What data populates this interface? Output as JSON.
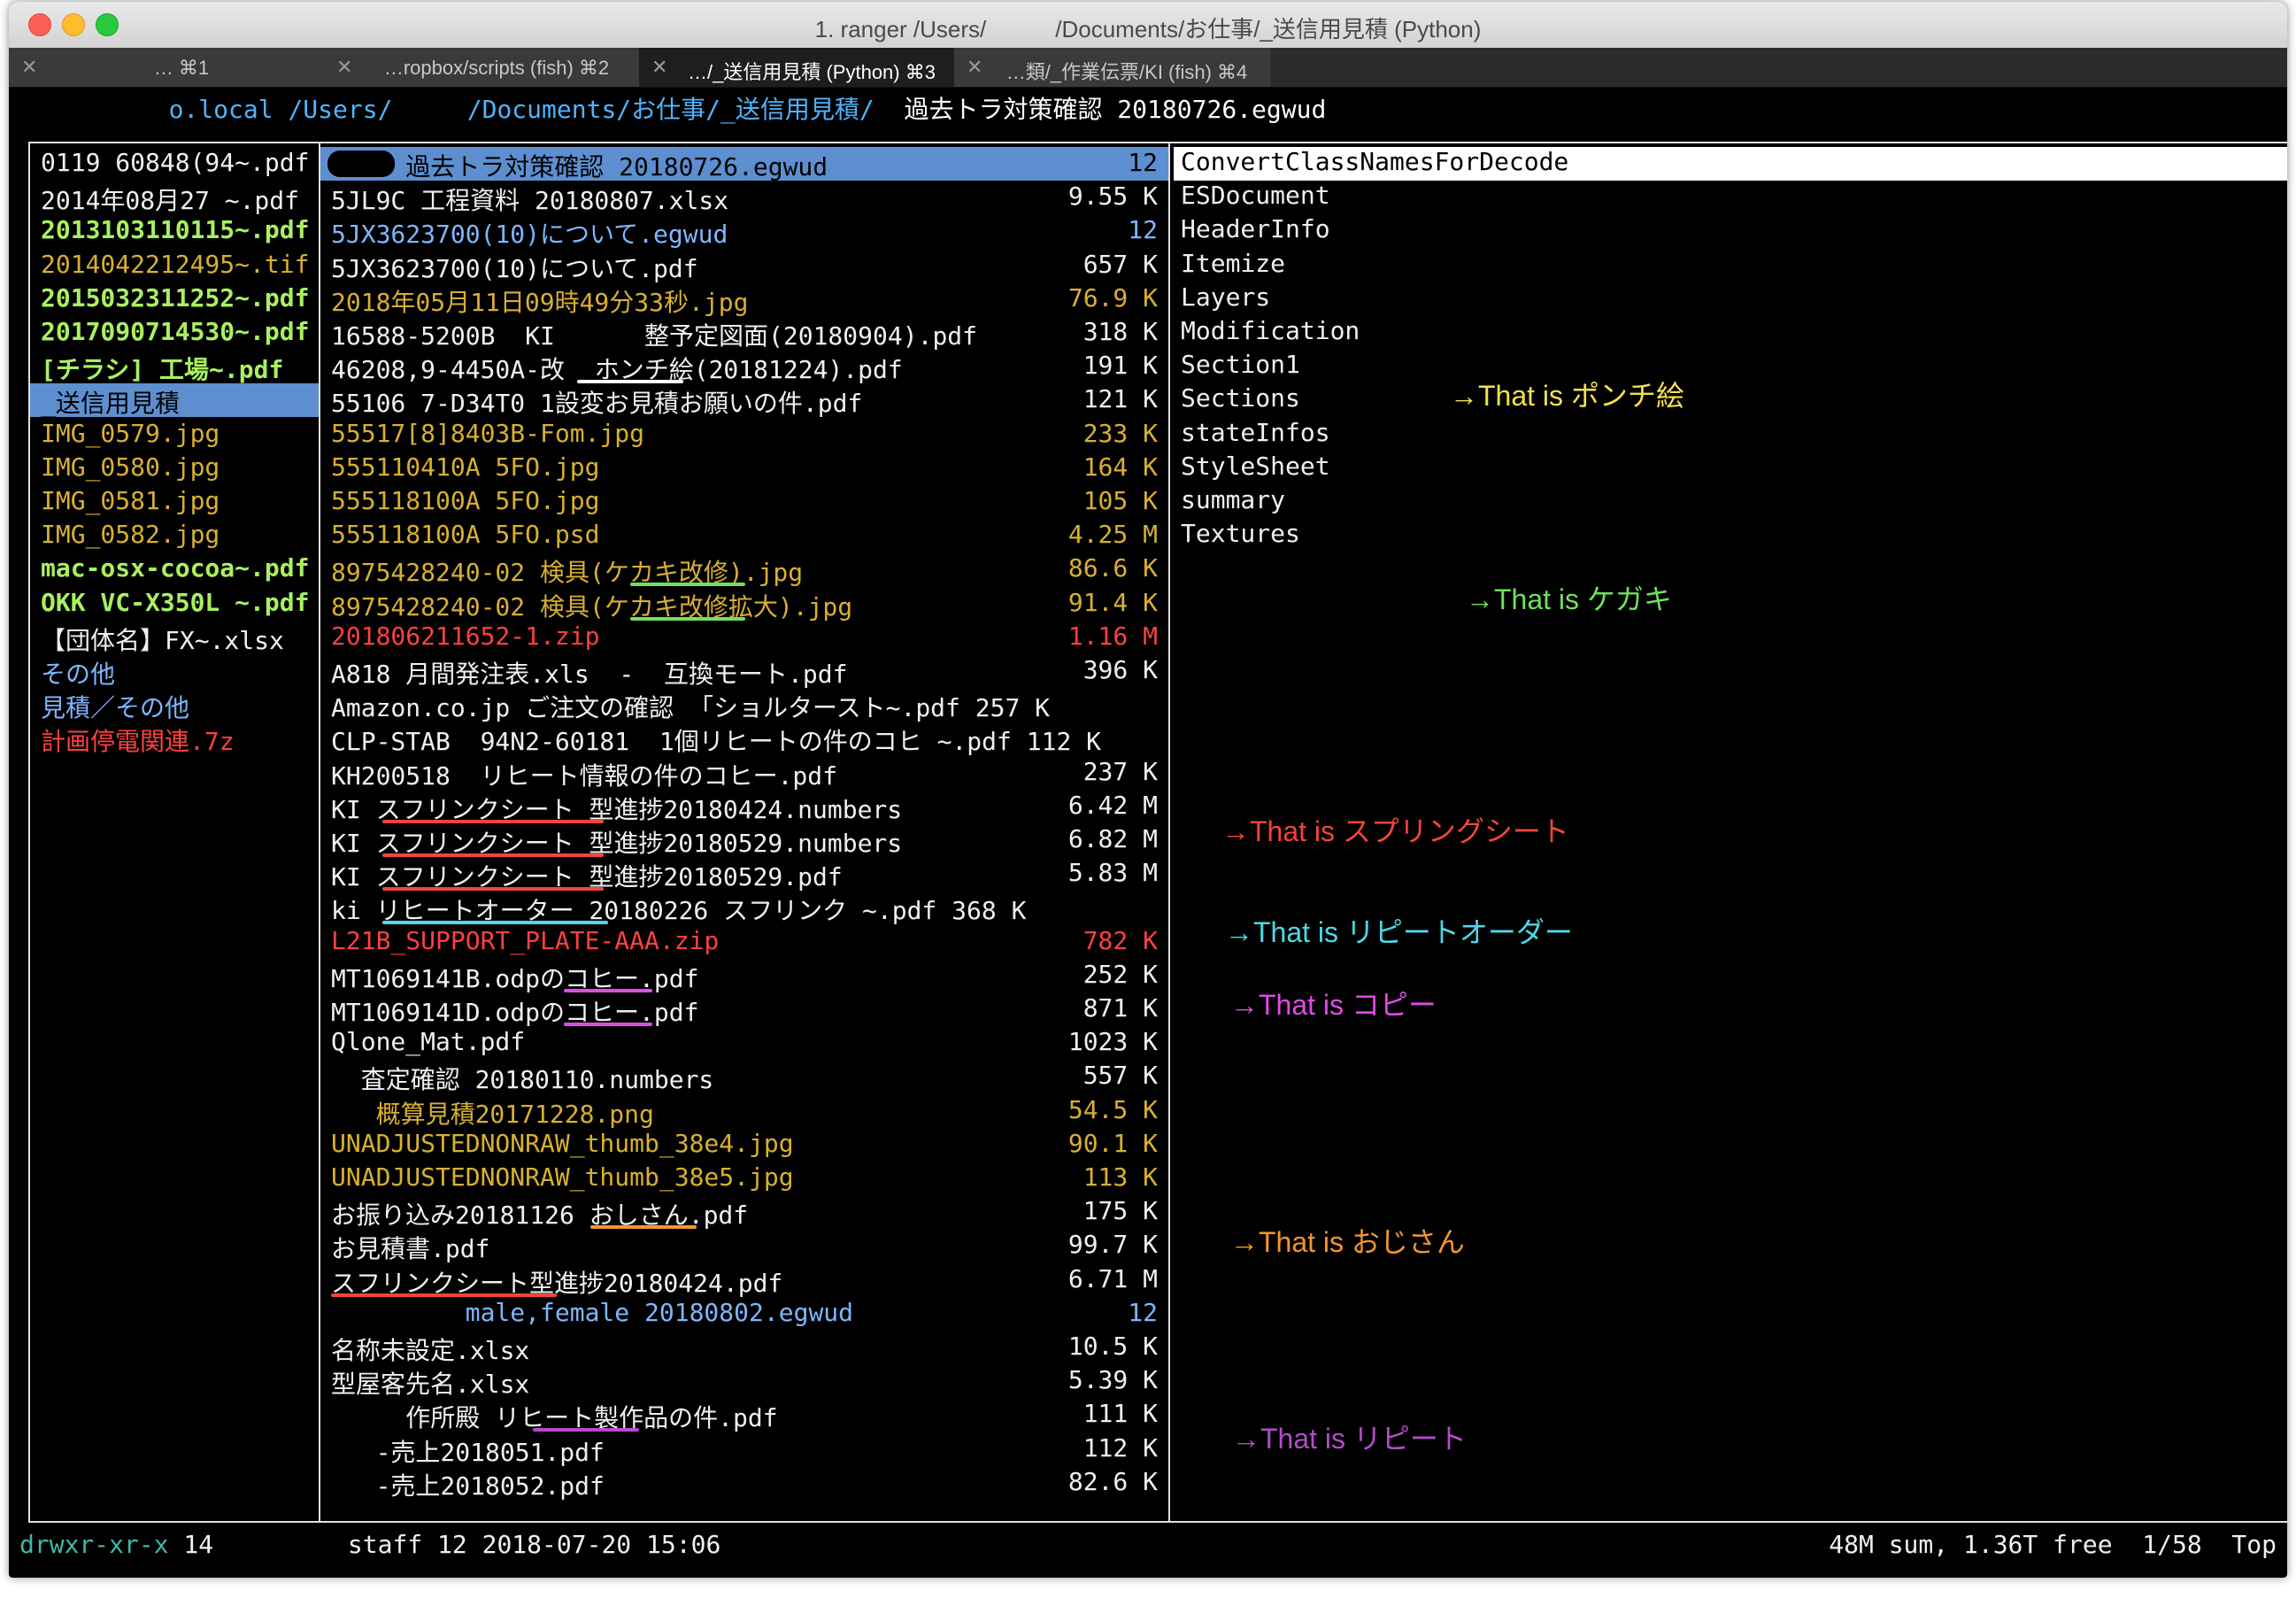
{
  "window": {
    "title": "1. ranger /Users/      /Documents/お仕事/_送信用見積 (Python)"
  },
  "tabs": [
    {
      "label": "… ⌘1",
      "active": false
    },
    {
      "label": "…ropbox/scripts (fish)  ⌘2",
      "active": false
    },
    {
      "label": "…/_送信用見積 (Python)  ⌘3",
      "active": true
    },
    {
      "label": "…類/_作業伝票/KI (fish)  ⌘4",
      "active": false
    }
  ],
  "path": {
    "host": "          o.local ",
    "dir": "/Users/     /Documents/お仕事/_送信用見積/  ",
    "file": "過去トラ対策確認 20180726.egwud"
  },
  "left_pane": [
    {
      "name": "0119 60848(94~.pdf",
      "color": "white"
    },
    {
      "name": "2014年08月27 ~.pdf",
      "color": "white"
    },
    {
      "name": "2013103110115~.pdf",
      "color": "green"
    },
    {
      "name": "2014042212495~.tif",
      "color": "yellow"
    },
    {
      "name": "2015032311252~.pdf",
      "color": "green"
    },
    {
      "name": "2017090714530~.pdf",
      "color": "green"
    },
    {
      "name": "[チラシ] 工場~.pdf",
      "color": "green"
    },
    {
      "name": "_送信用見積",
      "color": "black",
      "selected": true
    },
    {
      "name": "IMG_0579.jpg",
      "color": "yellow"
    },
    {
      "name": "IMG_0580.jpg",
      "color": "yellow"
    },
    {
      "name": "IMG_0581.jpg",
      "color": "yellow"
    },
    {
      "name": "IMG_0582.jpg",
      "color": "yellow"
    },
    {
      "name": "mac-osx-cocoa~.pdf",
      "color": "green"
    },
    {
      "name": "OKK VC-X350L ~.pdf",
      "color": "green"
    },
    {
      "name": "【団体名】FX~.xlsx",
      "color": "white"
    },
    {
      "name": "その他",
      "color": "blue"
    },
    {
      "name": "見積／その他",
      "color": "blue"
    },
    {
      "name": "計画停電関連.7z",
      "color": "red"
    }
  ],
  "mid_pane": [
    {
      "name": "     過去トラ対策確認 20180726.egwud",
      "size": "12",
      "color": "black",
      "selected": true
    },
    {
      "name": "5JL9C 工程資料 20180807.xlsx",
      "size": "9.55 K",
      "color": "white"
    },
    {
      "name": "5JX3623700(10)について.egwud",
      "size": "12",
      "color": "blue"
    },
    {
      "name": "5JX3623700(10)について.pdf",
      "size": "657 K",
      "color": "white"
    },
    {
      "name": "2018年05月11日09時49分33秒.jpg",
      "size": "76.9 K",
      "color": "yellow"
    },
    {
      "name": "16588-5200B  KI      整予定図面(20180904).pdf",
      "size": "318 K",
      "color": "white"
    },
    {
      "name": "46208,9-4450A-改  ホンチ絵(20181224).pdf",
      "size": "191 K",
      "color": "white"
    },
    {
      "name": "55106 7-D34T0 1設変お見積お願いの件.pdf",
      "size": "121 K",
      "color": "white"
    },
    {
      "name": "55517[8]8403B-Fom.jpg",
      "size": "233 K",
      "color": "yellow"
    },
    {
      "name": "555110410A 5FO.jpg",
      "size": "164 K",
      "color": "yellow"
    },
    {
      "name": "555118100A 5FO.jpg",
      "size": "105 K",
      "color": "yellow"
    },
    {
      "name": "555118100A 5FO.psd",
      "size": "4.25 M",
      "color": "yellow"
    },
    {
      "name": "8975428240-02 検具(ケカキ改修).jpg",
      "size": "86.6 K",
      "color": "yellow"
    },
    {
      "name": "8975428240-02 検具(ケカキ改修拡大).jpg",
      "size": "91.4 K",
      "color": "yellow"
    },
    {
      "name": "201806211652-1.zip",
      "size": "1.16 M",
      "color": "red"
    },
    {
      "name": "A818 月間発注表.xls  -  互換モート.pdf",
      "size": "396 K",
      "color": "white"
    },
    {
      "name": "Amazon.co.jp ご注文の確認 「ショルタースト~.pdf 257 K",
      "size": "",
      "color": "white"
    },
    {
      "name": "CLP-STAB  94N2-60181  1個リヒートの件のコヒ ~.pdf 112 K",
      "size": "",
      "color": "white"
    },
    {
      "name": "KH200518  リヒート情報の件のコヒー.pdf",
      "size": "237 K",
      "color": "white"
    },
    {
      "name": "KI スフリンクシート 型進捗20180424.numbers",
      "size": "6.42 M",
      "color": "white"
    },
    {
      "name": "KI スフリンクシート 型進捗20180529.numbers",
      "size": "6.82 M",
      "color": "white"
    },
    {
      "name": "KI スフリンクシート 型進捗20180529.pdf",
      "size": "5.83 M",
      "color": "white"
    },
    {
      "name": "ki リヒートオーター 20180226 スフリンク ~.pdf 368 K",
      "size": "",
      "color": "white"
    },
    {
      "name": "L21B_SUPPORT_PLATE-AAA.zip",
      "size": "782 K",
      "color": "red"
    },
    {
      "name": "MT1069141B.odpのコヒー.pdf",
      "size": "252 K",
      "color": "white"
    },
    {
      "name": "MT1069141D.odpのコヒー.pdf",
      "size": "871 K",
      "color": "white"
    },
    {
      "name": "Qlone_Mat.pdf",
      "size": "1023 K",
      "color": "white"
    },
    {
      "name": "  査定確認 20180110.numbers",
      "size": "557 K",
      "color": "white"
    },
    {
      "name": "   概算見積20171228.png",
      "size": "54.5 K",
      "color": "yellow"
    },
    {
      "name": "UNADJUSTEDNONRAW_thumb_38e4.jpg",
      "size": "90.1 K",
      "color": "yellow"
    },
    {
      "name": "UNADJUSTEDNONRAW_thumb_38e5.jpg",
      "size": "113 K",
      "color": "yellow"
    },
    {
      "name": "お振り込み20181126 おしさん.pdf",
      "size": "175 K",
      "color": "white"
    },
    {
      "name": "お見積書.pdf",
      "size": "99.7 K",
      "color": "white"
    },
    {
      "name": "スフリンクシート型進捗20180424.pdf",
      "size": "6.71 M",
      "color": "white"
    },
    {
      "name": "         male,female 20180802.egwud",
      "size": "12",
      "color": "blue"
    },
    {
      "name": "名称未設定.xlsx",
      "size": "10.5 K",
      "color": "white"
    },
    {
      "name": "型屋客先名.xlsx",
      "size": "5.39 K",
      "color": "white"
    },
    {
      "name": "     作所殿 リヒート製作品の件.pdf",
      "size": "111 K",
      "color": "white"
    },
    {
      "name": "   -売上2018051.pdf",
      "size": "112 K",
      "color": "white"
    },
    {
      "name": "   -売上2018052.pdf",
      "size": "82.6 K",
      "color": "white"
    }
  ],
  "right_pane": [
    {
      "name": "ConvertClassNamesForDecode",
      "selected": true
    },
    {
      "name": "ESDocument"
    },
    {
      "name": "HeaderInfo"
    },
    {
      "name": "Itemize"
    },
    {
      "name": "Layers"
    },
    {
      "name": "Modification"
    },
    {
      "name": "Section1"
    },
    {
      "name": "Sections"
    },
    {
      "name": "stateInfos"
    },
    {
      "name": "StyleSheet"
    },
    {
      "name": "summary"
    },
    {
      "name": "Textures"
    }
  ],
  "annotations": [
    {
      "text": "→That is ポンチ絵",
      "color": "#f5e14a"
    },
    {
      "text": "→That is ケガキ",
      "color": "#6fe25a"
    },
    {
      "text": "→That is スプリングシート",
      "color": "#f2453a"
    },
    {
      "text": "→That is リピートオーダー",
      "color": "#4fd8ea"
    },
    {
      "text": "→That is コピー",
      "color": "#e24ae8"
    },
    {
      "text": "→That is おじさん",
      "color": "#f5962a"
    },
    {
      "text": "→That is リピート",
      "color": "#b44cc8"
    }
  ],
  "status": {
    "left": "drwxr-xr-x",
    "info": " 14         staff 12 2018-07-20 15:06",
    "right": "48M sum, 1.36T free  1/58  Top"
  }
}
